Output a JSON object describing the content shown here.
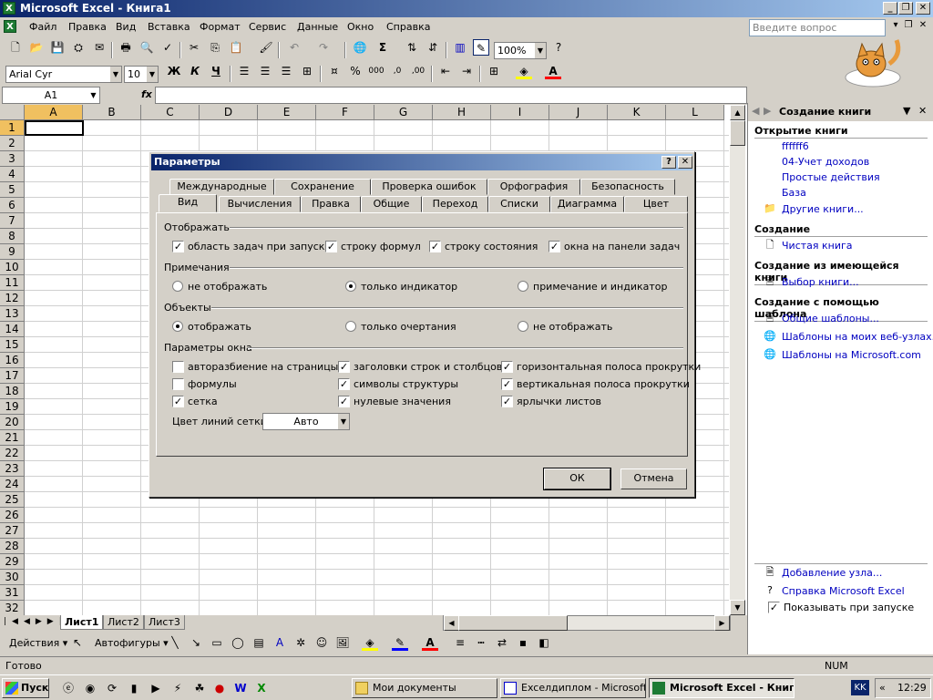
{
  "window": {
    "title": "Microsoft Excel - Книга1"
  },
  "menu": [
    "Файл",
    "Правка",
    "Вид",
    "Вставка",
    "Формат",
    "Сервис",
    "Данные",
    "Окно",
    "Справка"
  ],
  "ask": {
    "placeholder": "Введите вопрос"
  },
  "toolbar": {
    "zoom": "100%",
    "font": "Arial Cyr",
    "size": "10"
  },
  "formula": {
    "namebox": "A1",
    "fx": "fx",
    "value": ""
  },
  "grid": {
    "columns": [
      "A",
      "B",
      "C",
      "D",
      "E",
      "F",
      "G",
      "H",
      "I",
      "J",
      "K",
      "L"
    ],
    "rows": [
      "1",
      "2",
      "3",
      "4",
      "5",
      "6",
      "7",
      "8",
      "9",
      "10",
      "11",
      "12",
      "13",
      "14",
      "15",
      "16",
      "17",
      "18",
      "19",
      "20",
      "21",
      "22",
      "23",
      "24",
      "25",
      "26",
      "27",
      "28",
      "29",
      "30",
      "31",
      "32"
    ],
    "active_cell": "A1"
  },
  "sheets": [
    "Лист1",
    "Лист2",
    "Лист3"
  ],
  "draw": {
    "actions": "Действия",
    "autoshapes": "Автофигуры"
  },
  "status": {
    "left": "Готово",
    "num": "NUM"
  },
  "taskbar": {
    "start": "Пуск",
    "items": [
      "Мои документы",
      "Exceлдиплом - Microsoft...",
      "Microsoft Excel - Книг..."
    ],
    "lang": "KK",
    "clock": "12:29"
  },
  "taskpane": {
    "title": "Создание книги",
    "open_header": "Открытие книги",
    "open_items": [
      "ffffff6",
      "04-Учет доходов",
      "Простые действия",
      "База"
    ],
    "more": "Другие книги...",
    "create_header": "Создание",
    "blank": "Чистая книга",
    "from_existing_header": "Создание из имеющейся книги",
    "choose": "Выбор книги...",
    "template_header": "Создание с помощью шаблона",
    "templates": [
      "Общие шаблоны...",
      "Шаблоны на моих веб-узлах...",
      "Шаблоны на Microsoft.com"
    ],
    "add_place": "Добавление узла...",
    "help": "Справка Microsoft Excel",
    "show_at_startup": "Показывать при запуске"
  },
  "dialog": {
    "title": "Параметры",
    "tabs_top": [
      "Международные",
      "Сохранение",
      "Проверка ошибок",
      "Орфография",
      "Безопасность"
    ],
    "tabs_bottom": [
      "Вид",
      "Вычисления",
      "Правка",
      "Общие",
      "Переход",
      "Списки",
      "Диаграмма",
      "Цвет"
    ],
    "show": {
      "label": "Отображать",
      "items": [
        {
          "label": "область задач при запуске",
          "checked": true
        },
        {
          "label": "строку формул",
          "checked": true
        },
        {
          "label": "строку состояния",
          "checked": true
        },
        {
          "label": "окна на панели задач",
          "checked": true
        }
      ]
    },
    "comments": {
      "label": "Примечания",
      "options": [
        {
          "label": "не отображать",
          "selected": false
        },
        {
          "label": "только индикатор",
          "selected": true
        },
        {
          "label": "примечание и индикатор",
          "selected": false
        }
      ]
    },
    "objects": {
      "label": "Объекты",
      "options": [
        {
          "label": "отображать",
          "selected": true
        },
        {
          "label": "только очертания",
          "selected": false
        },
        {
          "label": "не отображать",
          "selected": false
        }
      ]
    },
    "window": {
      "label": "Параметры окна",
      "items": [
        {
          "label": "авторазбиение на страницы",
          "checked": false
        },
        {
          "label": "заголовки строк и столбцов",
          "checked": true
        },
        {
          "label": "горизонтальная полоса прокрутки",
          "checked": true
        },
        {
          "label": "формулы",
          "checked": false
        },
        {
          "label": "символы структуры",
          "checked": true
        },
        {
          "label": "вертикальная полоса прокрутки",
          "checked": true
        },
        {
          "label": "сетка",
          "checked": true
        },
        {
          "label": "нулевые значения",
          "checked": true
        },
        {
          "label": "ярлычки листов",
          "checked": true
        }
      ],
      "grid_color_label": "Цвет линий сетки:",
      "grid_color_value": "Авто"
    },
    "ok": "ОК",
    "cancel": "Отмена"
  }
}
